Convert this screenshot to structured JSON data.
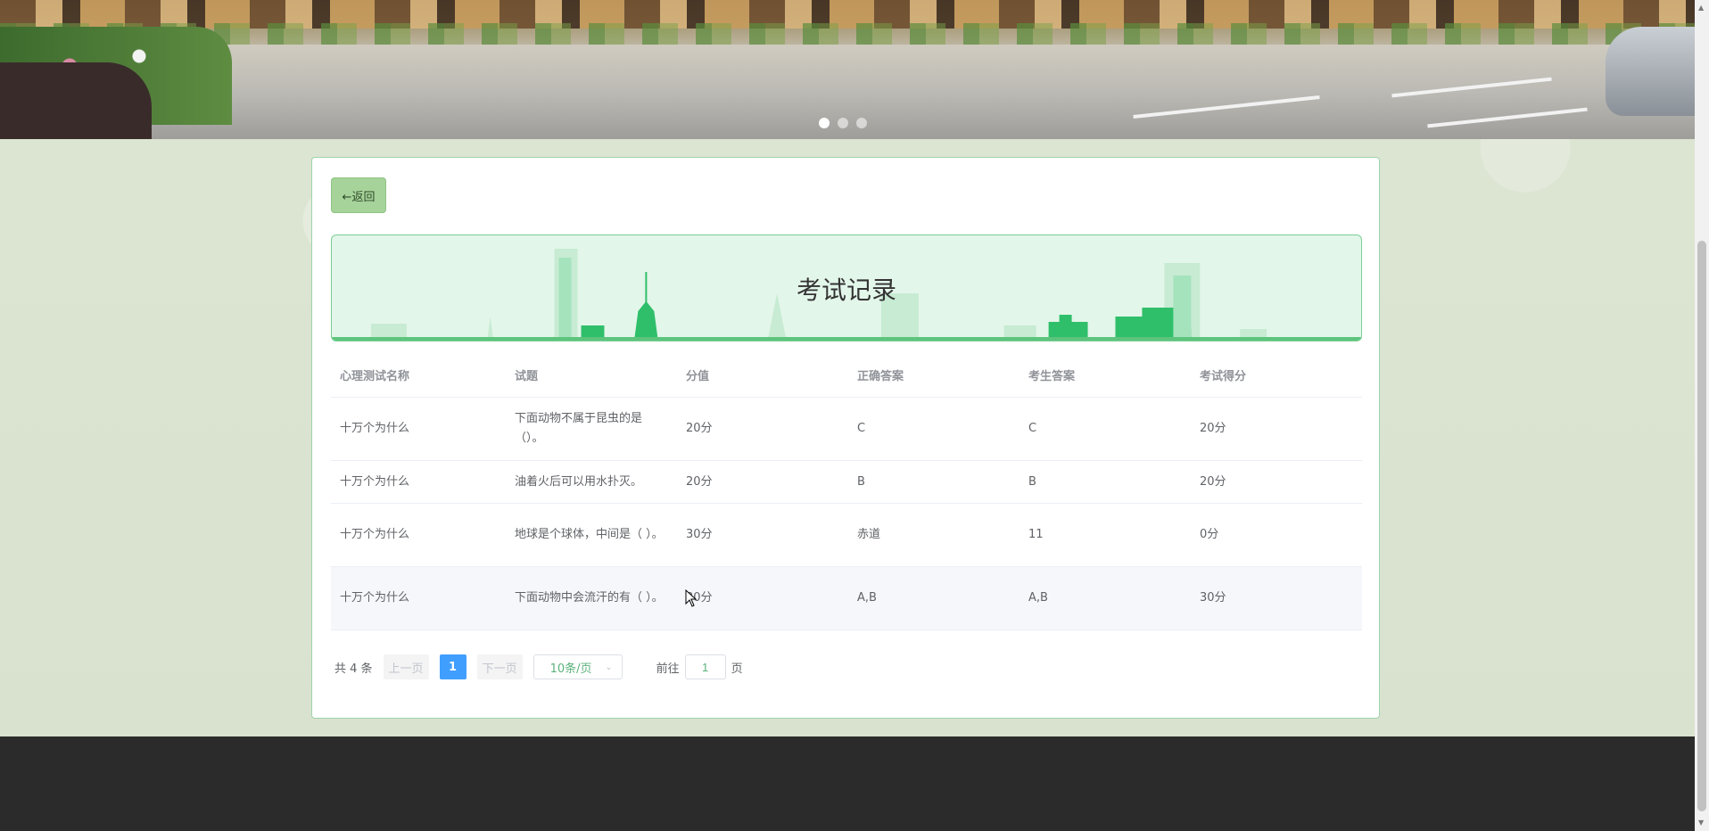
{
  "banner": {
    "active_slide": 1,
    "slide_count": 3
  },
  "back_button": {
    "label": "←返回"
  },
  "section_title": "考试记录",
  "table": {
    "headers": [
      "心理测试名称",
      "试题",
      "分值",
      "正确答案",
      "考生答案",
      "考试得分"
    ],
    "rows": [
      [
        "十万个为什么",
        "下面动物不属于昆虫的是（）。",
        "20分",
        "C",
        "C",
        "20分"
      ],
      [
        "十万个为什么",
        "油着火后可以用水扑灭。",
        "20分",
        "B",
        "B",
        "20分"
      ],
      [
        "十万个为什么",
        "地球是个球体，中间是（ ）。",
        "30分",
        "赤道",
        "11",
        "0分"
      ],
      [
        "十万个为什么",
        "下面动物中会流汗的有（ ）。",
        "30分",
        "A,B",
        "A,B",
        "30分"
      ]
    ]
  },
  "pagination": {
    "total": "共 4 条",
    "prev": "上一页",
    "current_page": "1",
    "next": "下一页",
    "page_size": "10条/页",
    "goto_label": "前往",
    "goto_value": "1",
    "page_unit": "页"
  },
  "colors": {
    "accent_green": "#5cc47c",
    "page_active": "#409eff",
    "back_button": "#a6d39a",
    "footer": "#2b2b2b"
  }
}
